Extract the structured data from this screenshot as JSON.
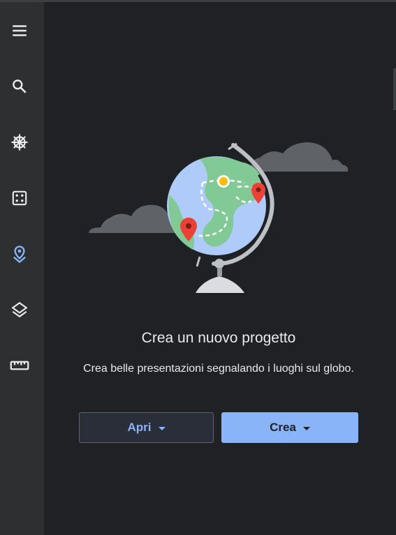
{
  "sidebar": {
    "items": [
      {
        "icon": "menu-icon",
        "label": "Menu"
      },
      {
        "icon": "search-icon",
        "label": "Search"
      },
      {
        "icon": "voyager-icon",
        "label": "Voyager"
      },
      {
        "icon": "dice-icon",
        "label": "Feeling lucky"
      },
      {
        "icon": "projects-icon",
        "label": "Projects",
        "active": true
      },
      {
        "icon": "layers-icon",
        "label": "Map style"
      },
      {
        "icon": "ruler-icon",
        "label": "Measure"
      }
    ]
  },
  "empty_state": {
    "title": "Crea un nuovo progetto",
    "description": "Crea belle presentazioni segnalando i luoghi sul globo."
  },
  "actions": {
    "open_label": "Apri",
    "create_label": "Crea"
  },
  "colors": {
    "accent": "#8ab4f8",
    "background": "#202124",
    "sidebar": "#2d2f31",
    "icon": "#e8eaed"
  }
}
